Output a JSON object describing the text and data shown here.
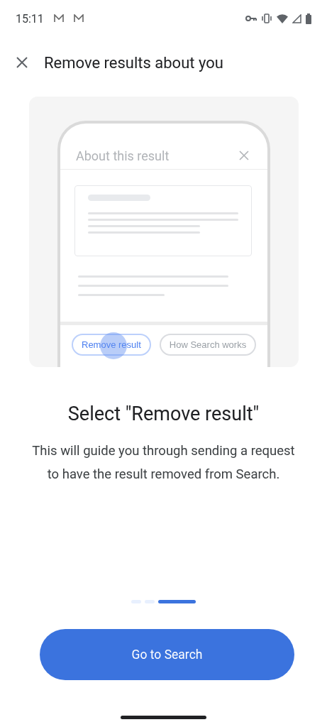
{
  "status_bar": {
    "time": "15:11"
  },
  "header": {
    "title": "Remove results about you"
  },
  "illustration": {
    "dialog_title": "About this result",
    "chips": [
      {
        "label": "Remove result",
        "selected": true
      },
      {
        "label": "How Search works",
        "selected": false
      }
    ]
  },
  "heading": "Select \"Remove result\"",
  "body": "This will guide you through sending a request to have the result removed from Search.",
  "pages": [
    {
      "selected": false
    },
    {
      "selected": false
    },
    {
      "selected": true
    }
  ],
  "primary_button": "Go to Search"
}
